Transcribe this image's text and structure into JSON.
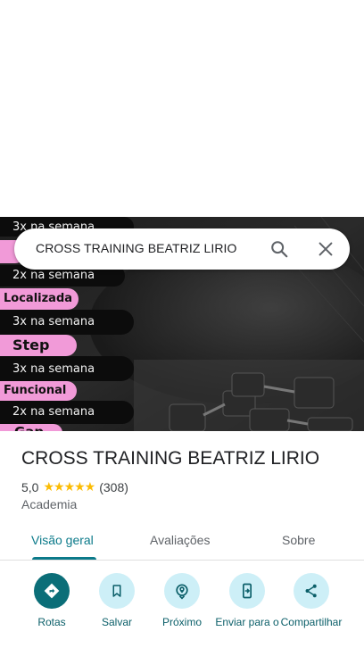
{
  "search": {
    "query": "CROSS TRAINING BEATRIZ LIRIO"
  },
  "hero_image": {
    "promo_lines": [
      "3x na semana",
      "2x na semana",
      "Localizada",
      "3x na semana",
      "Step",
      "3x na semana",
      "Funcional",
      "2x na semana",
      "Gap"
    ]
  },
  "place": {
    "name": "CROSS TRAINING BEATRIZ LIRIO",
    "rating": "5,0",
    "stars": "★★★★★",
    "review_count": "(308)",
    "category": "Academia"
  },
  "tabs": [
    {
      "label": "Visão geral",
      "active": true
    },
    {
      "label": "Avaliações",
      "active": false
    },
    {
      "label": "Sobre",
      "active": false
    }
  ],
  "actions": [
    {
      "label": "Rotas",
      "icon": "directions-icon"
    },
    {
      "label": "Salvar",
      "icon": "bookmark-icon"
    },
    {
      "label": "Próximo",
      "icon": "nearby-icon"
    },
    {
      "label": "Enviar para o",
      "icon": "send-to-phone-icon"
    },
    {
      "label": "Compartilhar",
      "icon": "share-icon"
    }
  ],
  "colors": {
    "accent": "#0b7a8a",
    "primary_action": "#0b6e78",
    "action_bg": "#cdeff7",
    "stars": "#fbbc04",
    "promo_pink": "#f19ad8"
  }
}
